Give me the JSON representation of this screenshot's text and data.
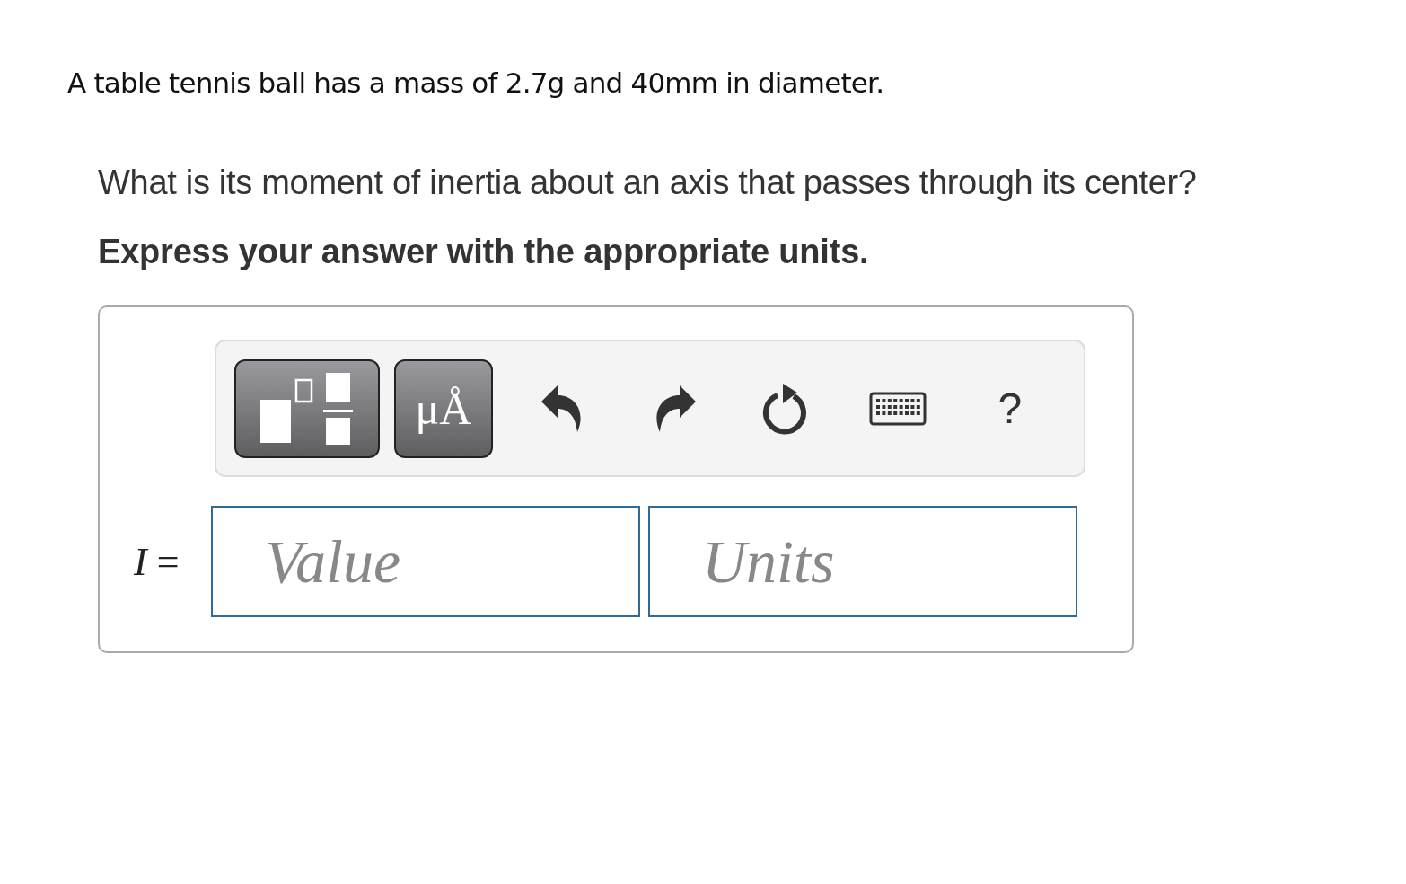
{
  "intro": "A table tennis ball has a mass of 2.7g and 40mm in diameter.",
  "question": "What is its moment of inertia about an axis that passes through its center?",
  "instruction": "Express your answer with the appropriate units.",
  "toolbar": {
    "symbol_button": "μÅ",
    "help": "?"
  },
  "answer": {
    "label": "*I* =",
    "value_placeholder": "Value",
    "units_placeholder": "Units"
  }
}
